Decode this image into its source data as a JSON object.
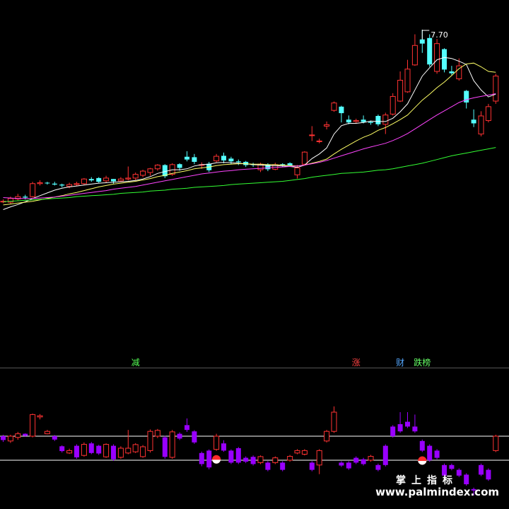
{
  "chart_data": [
    {
      "type": "candlestick",
      "panel": "price",
      "high_annotation": "7.70",
      "up_color": "#ff3232",
      "down_color": "#54ffff",
      "candles": [
        [
          4.0,
          4.0,
          3.96,
          4.04
        ],
        [
          3.98,
          4.06,
          3.95,
          4.1
        ],
        [
          4.05,
          4.1,
          4.02,
          4.16
        ],
        [
          4.1,
          4.08,
          4.04,
          4.14
        ],
        [
          4.1,
          4.38,
          4.08,
          4.42
        ],
        [
          4.38,
          4.4,
          4.34,
          4.45
        ],
        [
          4.4,
          4.39,
          4.36,
          4.42
        ],
        [
          4.38,
          4.36,
          4.34,
          4.42
        ],
        [
          4.36,
          4.34,
          4.3,
          4.38
        ],
        [
          4.32,
          4.36,
          4.28,
          4.4
        ],
        [
          4.36,
          4.38,
          4.33,
          4.42
        ],
        [
          4.38,
          4.48,
          4.35,
          4.5
        ],
        [
          4.48,
          4.45,
          4.42,
          4.52
        ],
        [
          4.5,
          4.42,
          4.4,
          4.52
        ],
        [
          4.44,
          4.5,
          4.4,
          4.55
        ],
        [
          4.48,
          4.43,
          4.38,
          4.48
        ],
        [
          4.44,
          4.48,
          4.42,
          4.52
        ],
        [
          4.48,
          4.5,
          4.45,
          4.75
        ],
        [
          4.5,
          4.58,
          4.45,
          4.62
        ],
        [
          4.56,
          4.65,
          4.52,
          4.68
        ],
        [
          4.62,
          4.7,
          4.55,
          4.72
        ],
        [
          4.7,
          4.78,
          4.66,
          4.8
        ],
        [
          4.78,
          4.54,
          4.5,
          4.8
        ],
        [
          4.58,
          4.79,
          4.55,
          4.82
        ],
        [
          4.8,
          4.72,
          4.66,
          4.82
        ],
        [
          4.96,
          4.9,
          4.86,
          5.08
        ],
        [
          4.95,
          4.85,
          4.8,
          5.02
        ],
        [
          4.79,
          4.79,
          4.7,
          4.84
        ],
        [
          4.81,
          4.67,
          4.63,
          4.85
        ],
        [
          4.87,
          4.97,
          4.84,
          5.02
        ],
        [
          4.98,
          4.88,
          4.82,
          5.05
        ],
        [
          4.92,
          4.86,
          4.8,
          4.96
        ],
        [
          4.86,
          4.84,
          4.78,
          4.9
        ],
        [
          4.85,
          4.78,
          4.74,
          4.87
        ],
        [
          4.8,
          4.78,
          4.74,
          4.83
        ],
        [
          4.68,
          4.8,
          4.63,
          4.83
        ],
        [
          4.79,
          4.69,
          4.65,
          4.82
        ],
        [
          4.69,
          4.79,
          4.67,
          4.83
        ],
        [
          4.8,
          4.78,
          4.74,
          4.82
        ],
        [
          4.82,
          4.77,
          4.74,
          4.84
        ],
        [
          4.57,
          4.72,
          4.49,
          4.78
        ],
        [
          4.8,
          5.06,
          4.77,
          5.08
        ],
        [
          5.42,
          5.43,
          5.3,
          5.62
        ],
        [
          5.29,
          5.3,
          5.25,
          5.35
        ],
        [
          5.62,
          5.65,
          5.55,
          5.72
        ],
        [
          5.96,
          6.12,
          5.93,
          6.15
        ],
        [
          6.04,
          5.9,
          5.7,
          6.06
        ],
        [
          5.76,
          5.7,
          5.66,
          5.85
        ],
        [
          5.72,
          5.74,
          5.68,
          5.78
        ],
        [
          5.76,
          5.71,
          5.68,
          5.85
        ],
        [
          5.71,
          5.69,
          5.65,
          5.74
        ],
        [
          5.84,
          5.66,
          5.62,
          5.87
        ],
        [
          5.66,
          5.86,
          5.45,
          5.91
        ],
        [
          5.88,
          6.26,
          5.85,
          6.33
        ],
        [
          6.16,
          6.61,
          6.14,
          6.8
        ],
        [
          6.36,
          6.85,
          6.34,
          7.05
        ],
        [
          6.94,
          7.36,
          6.92,
          7.6
        ],
        [
          7.49,
          7.4,
          7.2,
          7.7
        ],
        [
          7.52,
          6.95,
          6.9,
          7.6
        ],
        [
          6.8,
          7.4,
          6.75,
          7.5
        ],
        [
          7.28,
          6.84,
          6.78,
          7.3
        ],
        [
          6.8,
          6.76,
          6.72,
          6.92
        ],
        [
          6.64,
          6.92,
          6.6,
          7.08
        ],
        [
          6.38,
          6.13,
          6.0,
          6.4
        ],
        [
          5.76,
          5.68,
          5.6,
          5.98
        ],
        [
          5.45,
          5.84,
          5.4,
          5.94
        ],
        [
          5.74,
          6.04,
          5.7,
          6.1
        ],
        [
          6.16,
          6.7,
          6.1,
          6.75
        ]
      ],
      "ma_lines": [
        {
          "color": "#ffffff",
          "values": [
            3.82,
            3.88,
            3.93,
            3.99,
            4.06,
            4.12,
            4.18,
            4.24,
            4.28,
            4.31,
            4.33,
            4.35,
            4.37,
            4.39,
            4.4,
            4.41,
            4.42,
            4.43,
            4.45,
            4.48,
            4.53,
            4.6,
            4.64,
            4.68,
            4.68,
            4.7,
            4.76,
            4.79,
            4.8,
            4.83,
            4.84,
            4.83,
            4.82,
            4.81,
            4.79,
            4.78,
            4.77,
            4.77,
            4.76,
            4.75,
            4.73,
            4.78,
            4.92,
            5.02,
            5.15,
            5.45,
            5.63,
            5.68,
            5.68,
            5.7,
            5.73,
            5.72,
            5.72,
            5.79,
            5.93,
            6.1,
            6.4,
            6.7,
            6.88,
            7.05,
            7.1,
            7.08,
            7.02,
            6.95,
            6.6,
            6.4,
            6.25,
            6.31
          ]
        },
        {
          "color": "#ffff66",
          "values": [
            3.92,
            3.94,
            3.96,
            3.98,
            4.0,
            4.03,
            4.06,
            4.09,
            4.12,
            4.16,
            4.19,
            4.23,
            4.27,
            4.31,
            4.34,
            4.37,
            4.39,
            4.41,
            4.43,
            4.46,
            4.49,
            4.53,
            4.56,
            4.6,
            4.63,
            4.66,
            4.7,
            4.72,
            4.74,
            4.77,
            4.79,
            4.8,
            4.81,
            4.81,
            4.8,
            4.8,
            4.79,
            4.79,
            4.78,
            4.77,
            4.76,
            4.78,
            4.82,
            4.86,
            4.91,
            5.02,
            5.12,
            5.21,
            5.3,
            5.38,
            5.44,
            5.53,
            5.59,
            5.67,
            5.76,
            5.86,
            6.02,
            6.18,
            6.31,
            6.45,
            6.57,
            6.71,
            6.86,
            6.96,
            6.98,
            6.9,
            6.8,
            6.78
          ]
        },
        {
          "color": "#ff44ff",
          "values": [
            4.08,
            4.07,
            4.06,
            4.06,
            4.06,
            4.07,
            4.08,
            4.09,
            4.11,
            4.13,
            4.15,
            4.17,
            4.19,
            4.21,
            4.23,
            4.26,
            4.28,
            4.3,
            4.32,
            4.35,
            4.38,
            4.41,
            4.44,
            4.47,
            4.5,
            4.53,
            4.56,
            4.59,
            4.61,
            4.63,
            4.65,
            4.66,
            4.68,
            4.69,
            4.7,
            4.71,
            4.72,
            4.73,
            4.74,
            4.75,
            4.76,
            4.78,
            4.81,
            4.84,
            4.88,
            4.93,
            4.98,
            5.03,
            5.08,
            5.13,
            5.17,
            5.21,
            5.25,
            5.31,
            5.38,
            5.46,
            5.56,
            5.66,
            5.76,
            5.86,
            5.95,
            6.04,
            6.13,
            6.19,
            6.23,
            6.26,
            6.29,
            6.32
          ]
        },
        {
          "color": "#33ff33",
          "values": [
            3.99,
            4.0,
            4.01,
            4.02,
            4.03,
            4.04,
            4.05,
            4.06,
            4.07,
            4.08,
            4.1,
            4.11,
            4.12,
            4.13,
            4.14,
            4.15,
            4.17,
            4.18,
            4.19,
            4.2,
            4.22,
            4.23,
            4.24,
            4.26,
            4.27,
            4.28,
            4.3,
            4.31,
            4.32,
            4.33,
            4.34,
            4.36,
            4.37,
            4.38,
            4.39,
            4.4,
            4.41,
            4.42,
            4.43,
            4.45,
            4.47,
            4.49,
            4.52,
            4.54,
            4.56,
            4.58,
            4.6,
            4.61,
            4.62,
            4.63,
            4.65,
            4.67,
            4.68,
            4.7,
            4.73,
            4.76,
            4.79,
            4.82,
            4.86,
            4.9,
            4.94,
            4.98,
            5.01,
            5.04,
            5.07,
            5.1,
            5.13,
            5.16
          ]
        }
      ],
      "ylim": [
        3.7,
        7.8
      ]
    },
    {
      "type": "candlestick",
      "panel": "indicator",
      "up_color": "#ff3232",
      "down_color": "#9900ff",
      "reference_lines": [
        10,
        0
      ],
      "ylim": [
        -16,
        23
      ],
      "candles": [
        [
          10.0,
          8.4,
          7.6,
          10.6
        ],
        [
          8.0,
          10.0,
          7.2,
          10.6
        ],
        [
          9.5,
          11.0,
          8.5,
          11.8
        ],
        [
          11.0,
          10.2,
          9.7,
          11.2
        ],
        [
          10.0,
          19.0,
          9.5,
          19.4
        ],
        [
          18.0,
          18.5,
          17.0,
          19.2
        ],
        [
          11.0,
          12.0,
          10.8,
          12.6
        ],
        [
          10.0,
          8.6,
          8.0,
          10.5
        ],
        [
          5.8,
          3.8,
          3.2,
          6.2
        ],
        [
          3.0,
          4.0,
          2.6,
          4.8
        ],
        [
          6.0,
          1.2,
          0.6,
          6.6
        ],
        [
          2.0,
          6.6,
          1.5,
          7.4
        ],
        [
          7.0,
          3.0,
          2.5,
          7.6
        ],
        [
          6.0,
          2.8,
          2.2,
          6.4
        ],
        [
          1.4,
          6.6,
          1.0,
          7.0
        ],
        [
          6.0,
          0.4,
          -0.3,
          6.6
        ],
        [
          1.2,
          5.0,
          0.6,
          5.8
        ],
        [
          3.0,
          5.0,
          2.5,
          12.6
        ],
        [
          3.5,
          6.5,
          3.0,
          7.1
        ],
        [
          1.5,
          5.6,
          1.0,
          6.3
        ],
        [
          4.0,
          12.0,
          3.2,
          12.8
        ],
        [
          10.0,
          12.4,
          9.2,
          13.0
        ],
        [
          9.5,
          1.4,
          0.6,
          10.2
        ],
        [
          1.2,
          11.8,
          0.6,
          12.6
        ],
        [
          11.0,
          9.0,
          8.4,
          11.6
        ],
        [
          14.6,
          12.6,
          11.8,
          17.4
        ],
        [
          12.0,
          7.4,
          6.8,
          12.5
        ],
        [
          3.0,
          -1.6,
          -2.5,
          3.6
        ],
        [
          4.0,
          -3.0,
          -3.8,
          4.5
        ],
        [
          4.5,
          10.0,
          3.9,
          11.0
        ],
        [
          7.0,
          4.0,
          3.5,
          8.3
        ],
        [
          4.0,
          -1.0,
          -1.6,
          4.5
        ],
        [
          5.0,
          -1.0,
          -1.6,
          5.5
        ],
        [
          1.0,
          -0.6,
          -1.2,
          1.6
        ],
        [
          1.4,
          -1.6,
          -2.2,
          2.0
        ],
        [
          -1.0,
          1.5,
          -1.6,
          2.0
        ],
        [
          -1.0,
          -4.0,
          -4.6,
          -0.4
        ],
        [
          -1.0,
          1.0,
          -1.6,
          1.6
        ],
        [
          -1.0,
          -4.0,
          -4.6,
          -0.4
        ],
        [
          0.0,
          1.6,
          -0.6,
          2.2
        ],
        [
          3.0,
          4.0,
          2.5,
          4.6
        ],
        [
          2.5,
          4.0,
          2.0,
          4.6
        ],
        [
          -1.0,
          -4.0,
          -4.6,
          -0.4
        ],
        [
          -2.0,
          4.0,
          -5.8,
          4.6
        ],
        [
          8.0,
          12.0,
          7.4,
          12.6
        ],
        [
          12.0,
          20.0,
          11.4,
          22.4
        ],
        [
          -1.0,
          -2.2,
          -2.8,
          -0.4
        ],
        [
          -1.0,
          -3.4,
          -4.0,
          -0.4
        ],
        [
          1.0,
          -1.0,
          -1.6,
          1.6
        ],
        [
          0.4,
          -1.6,
          -2.2,
          1.0
        ],
        [
          0.0,
          1.6,
          -0.6,
          2.2
        ],
        [
          -2.0,
          -4.0,
          -4.6,
          -1.4
        ],
        [
          6.0,
          -2.0,
          -2.6,
          6.6
        ],
        [
          14.0,
          10.0,
          9.4,
          14.6
        ],
        [
          15.0,
          12.0,
          11.4,
          20.0
        ],
        [
          16.0,
          14.0,
          13.4,
          20.0
        ],
        [
          14.0,
          12.0,
          11.4,
          19.0
        ],
        [
          8.0,
          4.0,
          3.4,
          8.6
        ],
        [
          6.0,
          0.0,
          -0.6,
          6.6
        ],
        [
          4.0,
          1.0,
          0.4,
          4.6
        ],
        [
          -2.0,
          -6.4,
          -7.0,
          -1.4
        ],
        [
          -2.0,
          -3.6,
          -4.2,
          -1.4
        ],
        [
          -4.0,
          -6.4,
          -7.0,
          -3.4
        ],
        [
          -6.0,
          -10.0,
          -10.6,
          -5.4
        ],
        [
          -12.0,
          -12.6,
          -14.6,
          -11.4
        ],
        [
          -2.0,
          -6.0,
          -6.6,
          -1.4
        ],
        [
          -4.0,
          -8.0,
          -8.6,
          -3.4
        ],
        [
          4.0,
          10.0,
          3.4,
          10.6
        ]
      ]
    }
  ],
  "signals": [
    {
      "label": "减",
      "color": "#55ff55",
      "index": 18
    },
    {
      "label": "涨",
      "color": "#ff4444",
      "index": 48
    },
    {
      "label": "财",
      "color": "#55a8ff",
      "index": 54
    },
    {
      "label": "跌榜",
      "color": "#66ff66",
      "index": 57
    }
  ],
  "markers": [
    {
      "index": 29
    },
    {
      "index": 57
    }
  ],
  "watermark": {
    "cn": "掌上指标",
    "url": "www.palmindex.com"
  }
}
